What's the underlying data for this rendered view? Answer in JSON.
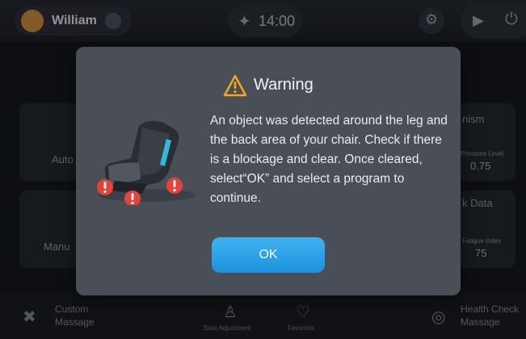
{
  "header": {
    "username": "William",
    "timer": "14:00"
  },
  "cards": {
    "left_top_label": "Auto",
    "left_bottom_label": "Manu",
    "right_top_title": "nism",
    "right_top_small": "Pressure Level",
    "right_top_value": "0.75",
    "right_bottom_title": "k Data",
    "right_bottom_small": "Fatigue Index",
    "right_bottom_value": "75"
  },
  "bottom_nav": {
    "custom_line1": "Custom",
    "custom_line2": "Massage",
    "seat_adjustment": "Seat Adjustment",
    "favorites": "Favorites",
    "health_line1": "Health Check",
    "health_line2": "Massage"
  },
  "modal": {
    "title": "Warning",
    "message": "An object was detected around the leg and the back area of your chair. Check if there is a blockage and clear. Once cleared, select“OK” and select a program to continue.",
    "ok_label": "OK"
  },
  "colors": {
    "accent": "#2aa3e8",
    "warning": "#f2a81d",
    "alert": "#e0443a"
  },
  "icons": [
    "user-avatar-icon",
    "swap-icon",
    "timer-figure-icon",
    "gear-icon",
    "play-icon",
    "power-icon",
    "warning-icon",
    "massage-chair-icon",
    "custom-massage-icon",
    "seat-adjustment-icon",
    "heart-icon",
    "health-check-icon"
  ]
}
